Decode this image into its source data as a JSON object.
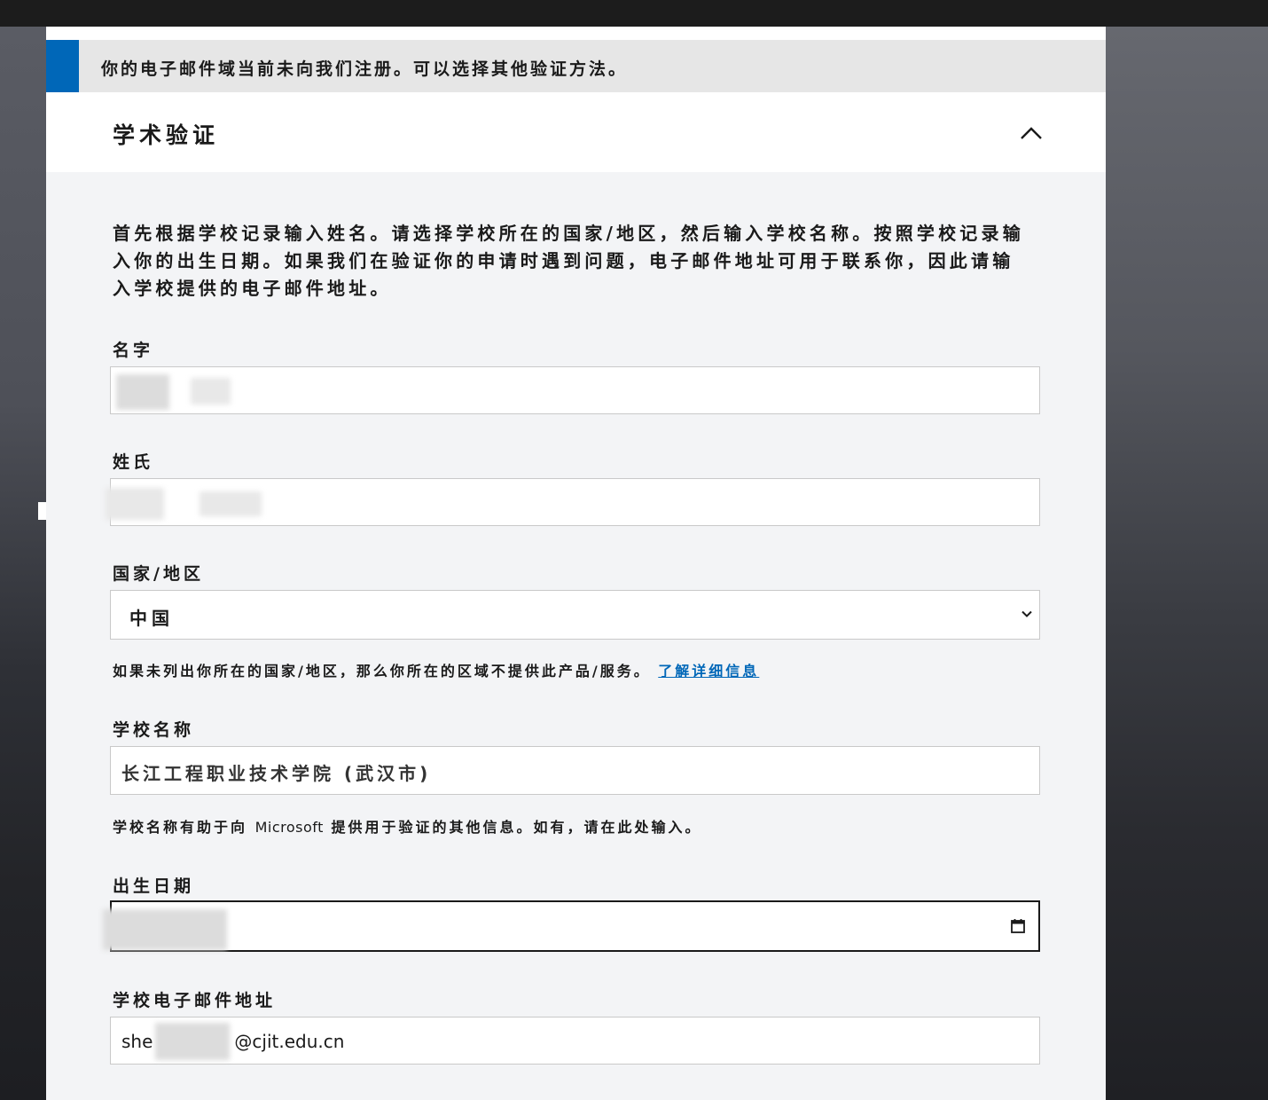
{
  "notice": {
    "text": "你的电子邮件域当前未向我们注册。可以选择其他验证方法。"
  },
  "section": {
    "title": "学术验证",
    "collapse_icon": "chevron-up-icon"
  },
  "intro": {
    "text": "首先根据学校记录输入姓名。请选择学校所在的国家/地区，然后输入学校名称。按照学校记录输入你的出生日期。如果我们在验证你的申请时遇到问题，电子邮件地址可用于联系你，因此请输入学校提供的电子邮件地址。"
  },
  "form": {
    "first_name": {
      "label": "名字",
      "value": ""
    },
    "last_name": {
      "label": "姓氏",
      "value": ""
    },
    "country": {
      "label": "国家/地区",
      "selected": "中国",
      "icon": "chevron-down-icon",
      "help_text": "如果未列出你所在的国家/地区，那么你所在的区域不提供此产品/服务。",
      "help_link": "了解详细信息"
    },
    "school": {
      "label": "学校名称",
      "value": "长江工程职业技术学院 (武汉市)",
      "help_prefix": "学校名称有助于向",
      "help_brand": "Microsoft",
      "help_suffix": "提供用于验证的其他信息。如有，请在此处输入。"
    },
    "birthdate": {
      "label": "出生日期",
      "value": "",
      "icon": "calendar-icon"
    },
    "email": {
      "label": "学校电子邮件地址",
      "value_prefix": "she",
      "value_suffix": "@cjit.edu.cn"
    }
  },
  "colors": {
    "accent": "#0067b8",
    "panel_bg": "#f3f4f6",
    "notice_bg": "#e6e6e6"
  }
}
